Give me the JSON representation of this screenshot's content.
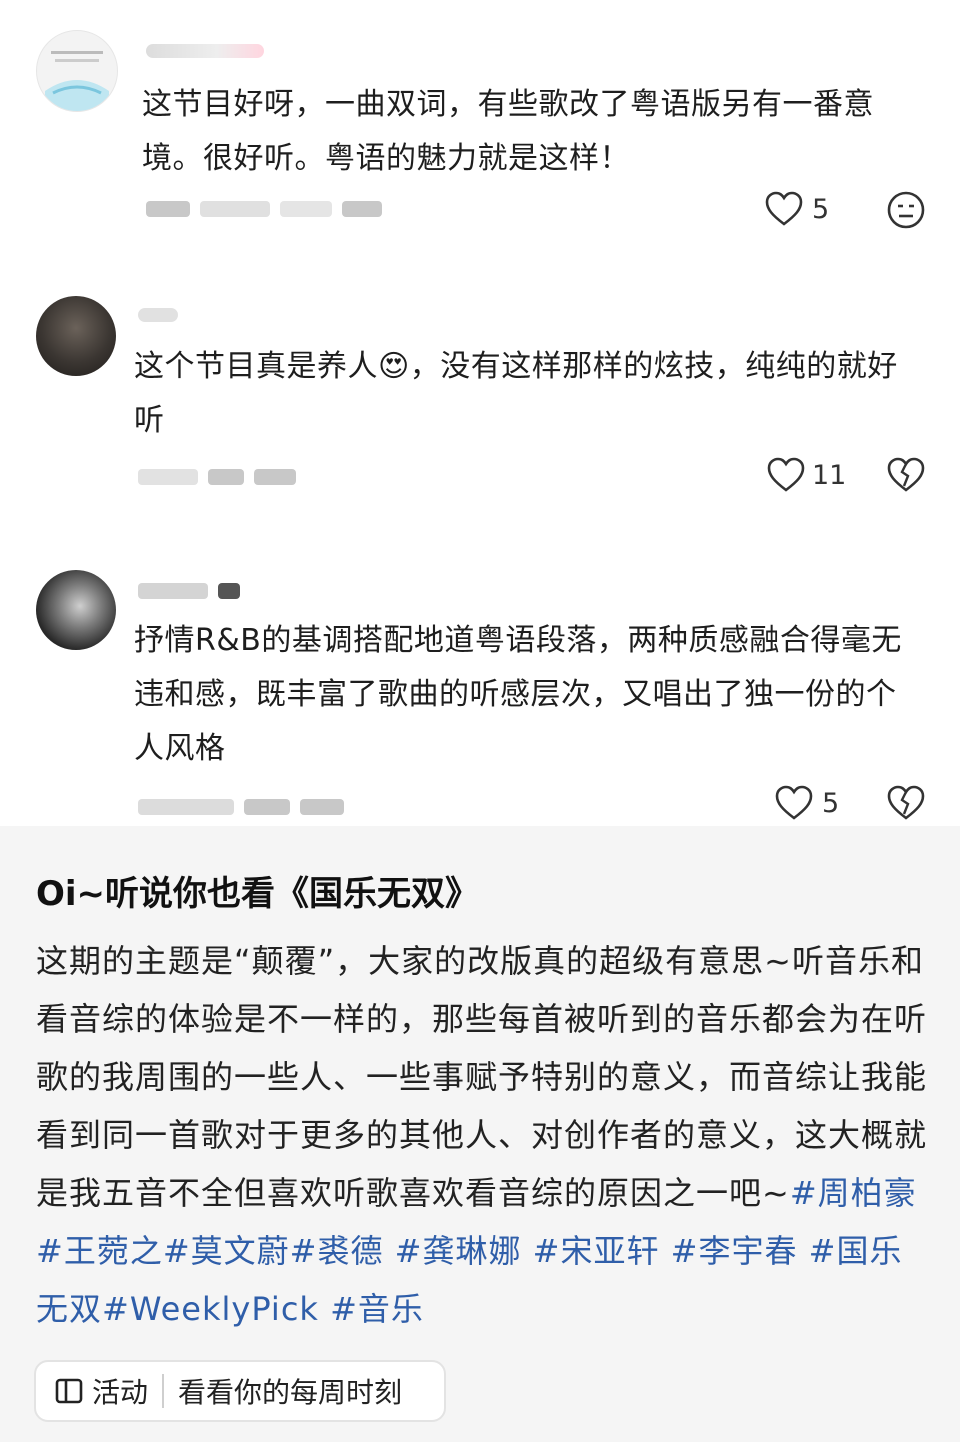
{
  "comments": [
    {
      "text": "这节目好呀，一曲双词，有些歌改了粤语版另有一番意境。很好听。粤语的魅力就是这样！",
      "likes": "5",
      "reaction_icon": "neutral-face-icon"
    },
    {
      "text_before_emoji": "这个节目真是养人",
      "emoji": "😍",
      "text_after_emoji": "，没有这样那样的炫技，纯纯的就好听",
      "likes": "11",
      "reaction_icon": "broken-heart-icon"
    },
    {
      "text": "抒情R&B的基调搭配地道粤语段落，两种质感融合得毫无违和感，既丰富了歌曲的听感层次，又唱出了独一份的个人风格",
      "likes": "5",
      "reaction_icon": "broken-heart-icon"
    }
  ],
  "post": {
    "title": "Oi~听说你也看《国乐无双》",
    "body": "这期的主题是“颠覆”，大家的改版真的超级有意思~听音乐和看音综的体验是不一样的，那些每首被听到的音乐都会为在听歌的我周围的一些人、一些事赋予特别的意义，而音综让我能看到同一首歌对于更多的其他人、对创作者的意义，这大概就是我五音不全但喜欢听歌喜欢看音综的原因之一吧~",
    "tags": [
      "#周柏豪",
      "#王菀之",
      "#莫文蔚",
      "#裘德",
      "#龚琳娜",
      "#宋亚轩",
      "#李宇春",
      "#国乐无双",
      "#WeeklyPick",
      "#音乐"
    ]
  },
  "activity": {
    "label": "活动",
    "text": "看看你的每周时刻"
  },
  "colors": {
    "tag": "#2f5ea9",
    "bottom_bg": "#f5f5f5"
  }
}
